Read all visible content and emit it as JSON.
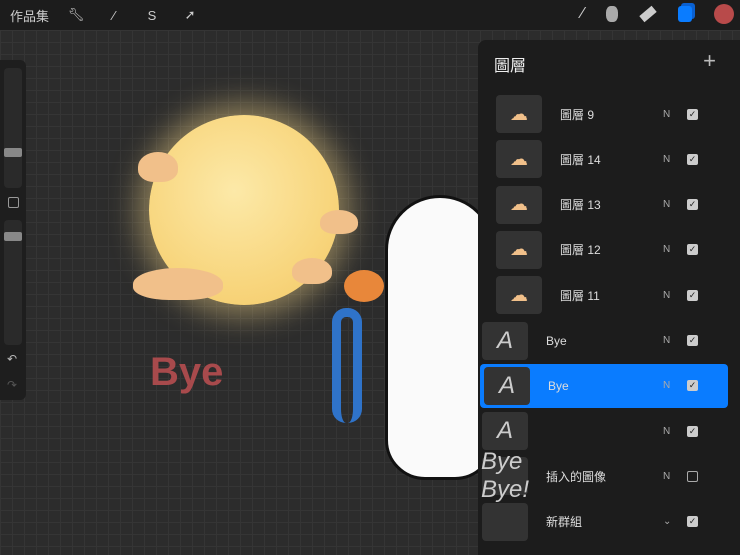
{
  "topbar": {
    "gallery": "作品集",
    "tools": [
      "wrench-icon",
      "magic-wand-icon",
      "selection-icon",
      "transform-icon"
    ],
    "right_tools": [
      "brush-icon",
      "smudge-icon",
      "eraser-icon",
      "layers-icon",
      "color-icon"
    ],
    "color": "#b84a4a",
    "accent": "#0a7cff"
  },
  "canvas": {
    "text": "Bye"
  },
  "layers": {
    "title": "圖層",
    "add": "+",
    "items": [
      {
        "name": "圖層 9",
        "blend": "N",
        "visible": true,
        "thumb": "☁"
      },
      {
        "name": "圖層 14",
        "blend": "N",
        "visible": true,
        "thumb": "☁"
      },
      {
        "name": "圖層 13",
        "blend": "N",
        "visible": true,
        "thumb": "☁"
      },
      {
        "name": "圖層 12",
        "blend": "N",
        "visible": true,
        "thumb": "☁"
      },
      {
        "name": "圖層 11",
        "blend": "N",
        "visible": true,
        "thumb": "☁"
      },
      {
        "name": "Bye",
        "blend": "N",
        "visible": true,
        "thumb": "A",
        "text": true
      },
      {
        "name": "Bye",
        "blend": "N",
        "visible": true,
        "thumb": "A",
        "text": true,
        "selected": true
      },
      {
        "name": "",
        "blend": "N",
        "visible": true,
        "thumb": "A",
        "text": true
      },
      {
        "name": "插入的圖像",
        "blend": "N",
        "visible": false,
        "thumb": "Bye Bye!",
        "text": true
      },
      {
        "name": "新群組",
        "blend": "⌄",
        "visible": true,
        "thumb": "",
        "text": true
      }
    ]
  }
}
